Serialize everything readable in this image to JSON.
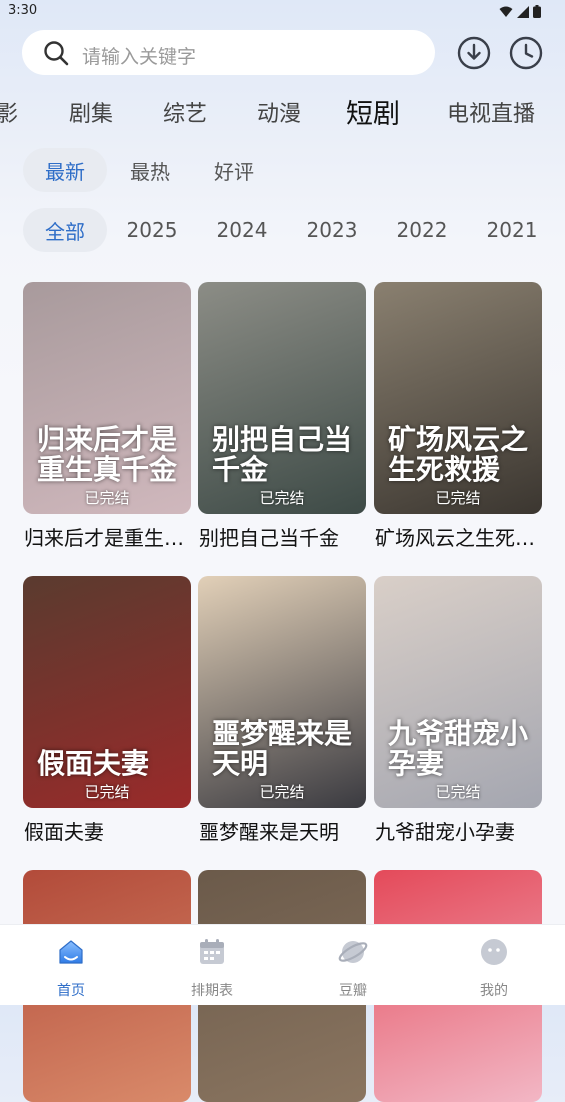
{
  "status": {
    "time": "3:30"
  },
  "search": {
    "placeholder": "请输入关键字"
  },
  "top_actions": {
    "download_icon": "download-icon",
    "history_icon": "clock-icon"
  },
  "categories": [
    {
      "label": "影"
    },
    {
      "label": "剧集"
    },
    {
      "label": "综艺"
    },
    {
      "label": "动漫"
    },
    {
      "label": "短剧",
      "active": true
    },
    {
      "label": "电视直播"
    }
  ],
  "sort_filters": [
    {
      "label": "最新",
      "active": true
    },
    {
      "label": "最热"
    },
    {
      "label": "好评"
    }
  ],
  "year_filters": [
    {
      "label": "全部",
      "active": true
    },
    {
      "label": "2025"
    },
    {
      "label": "2024"
    },
    {
      "label": "2023"
    },
    {
      "label": "2022"
    },
    {
      "label": "2021"
    }
  ],
  "items": [
    {
      "title": "归来后才是重生…",
      "tag": "已完结",
      "poster_text": "归来后才是重生真千金",
      "color_top": "#a89a9c",
      "color_bottom": "#d0b8bd"
    },
    {
      "title": "别把自己当千金",
      "tag": "已完结",
      "poster_text": "别把自己当千金",
      "color_top": "#8c8d86",
      "color_bottom": "#3d4a46"
    },
    {
      "title": "矿场风云之生死…",
      "tag": "已完结",
      "poster_text": "矿场风云之生死救援",
      "color_top": "#8a8070",
      "color_bottom": "#3b3630"
    },
    {
      "title": "假面夫妻",
      "tag": "已完结",
      "poster_text": "假面夫妻",
      "color_top": "#5a3b2f",
      "color_bottom": "#9a2a2a"
    },
    {
      "title": "噩梦醒来是天明",
      "tag": "已完结",
      "poster_text": "噩梦醒来是天明",
      "color_top": "#e2d0b8",
      "color_bottom": "#3a3a40"
    },
    {
      "title": "九爷甜宠小孕妻",
      "tag": "已完结",
      "poster_text": "九爷甜宠小孕妻",
      "color_top": "#d9cfc8",
      "color_bottom": "#a4a6b0"
    },
    {
      "title": "",
      "tag": "",
      "poster_text": "",
      "color_top": "#b24b3a",
      "color_bottom": "#d98a6a"
    },
    {
      "title": "",
      "tag": "",
      "poster_text": "",
      "color_top": "#6b5a4a",
      "color_bottom": "#8a7560"
    },
    {
      "title": "",
      "tag": "",
      "poster_text": "",
      "color_top": "#e44a5a",
      "color_bottom": "#f2b7c5"
    }
  ],
  "tabbar": [
    {
      "label": "首页",
      "icon": "home-icon",
      "active": true
    },
    {
      "label": "排期表",
      "icon": "calendar-icon"
    },
    {
      "label": "豆瓣",
      "icon": "planet-icon"
    },
    {
      "label": "我的",
      "icon": "profile-face-icon"
    }
  ],
  "colors": {
    "accent": "#2f6ec8",
    "chip_bg": "#e8ebf1"
  }
}
